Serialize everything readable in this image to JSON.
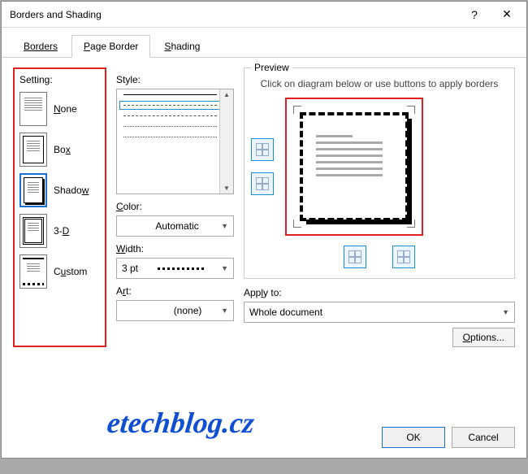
{
  "title": "Borders and Shading",
  "tabs": {
    "borders": "Borders",
    "page_border": "Page Border",
    "shading": "Shading"
  },
  "setting": {
    "label": "Setting:",
    "items": [
      {
        "label": "None",
        "key": "N"
      },
      {
        "label": "Box",
        "key": "x"
      },
      {
        "label": "Shadow",
        "key": "w",
        "selected": true
      },
      {
        "label": "3-D",
        "key": "D"
      },
      {
        "label": "Custom",
        "key": "U"
      }
    ]
  },
  "style": {
    "label": "Style:"
  },
  "color": {
    "label": "Color:",
    "value": "Automatic"
  },
  "width": {
    "label": "Width:",
    "value": "3 pt"
  },
  "art": {
    "label": "Art:",
    "value": "(none)"
  },
  "preview": {
    "legend": "Preview",
    "hint": "Click on diagram below or use buttons to apply borders"
  },
  "apply": {
    "label": "Apply to:",
    "value": "Whole document"
  },
  "options": "Options...",
  "ok": "OK",
  "cancel": "Cancel",
  "watermark": "etechblog.cz"
}
